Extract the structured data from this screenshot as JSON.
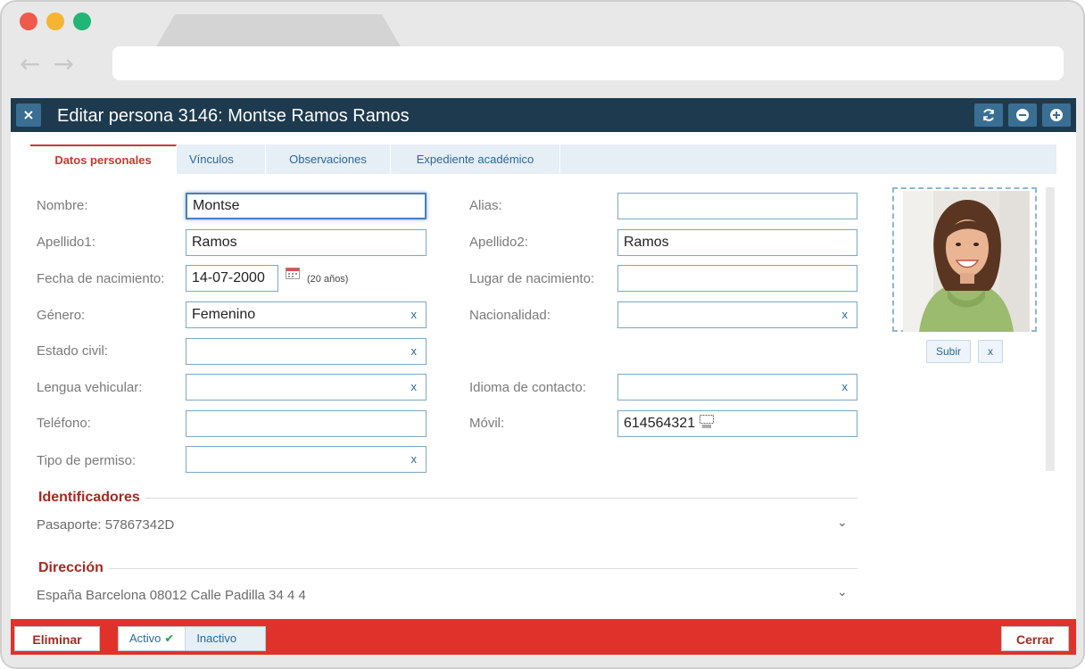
{
  "window": {
    "title": "Editar persona 3146: Montse Ramos Ramos",
    "close_glyph": "×"
  },
  "colors": {
    "titlebar": "#1d3a4f",
    "accent_red": "#e0322a",
    "section_red": "#a32a20",
    "link_blue": "#2a6a99"
  },
  "tabs": [
    {
      "label": "Datos personales",
      "active": true
    },
    {
      "label": "Vínculos",
      "active": false
    },
    {
      "label": "Observaciones",
      "active": false
    },
    {
      "label": "Expediente académico",
      "active": false
    }
  ],
  "form": {
    "nombre": {
      "label": "Nombre:",
      "value": "Montse"
    },
    "apellido1": {
      "label": "Apellido1:",
      "value": "Ramos"
    },
    "fecha": {
      "label": "Fecha de nacimiento:",
      "value": "14-07-2000",
      "age": "(20 años)"
    },
    "genero": {
      "label": "Género:",
      "value": "Femenino",
      "clear": "x"
    },
    "estado_civil": {
      "label": "Estado civil:",
      "value": "",
      "clear": "x"
    },
    "lengua": {
      "label": "Lengua vehicular:",
      "value": "",
      "clear": "x"
    },
    "telefono": {
      "label": "Teléfono:",
      "value": ""
    },
    "permiso": {
      "label": "Tipo de permiso:",
      "value": "",
      "clear": "x"
    },
    "alias": {
      "label": "Alias:",
      "value": ""
    },
    "apellido2": {
      "label": "Apellido2:",
      "value": "Ramos"
    },
    "lugar": {
      "label": "Lugar de nacimiento:",
      "value": ""
    },
    "nacionalidad": {
      "label": "Nacionalidad:",
      "value": "",
      "clear": "x"
    },
    "idioma": {
      "label": "Idioma de contacto:",
      "value": "",
      "clear": "x"
    },
    "movil": {
      "label": "Móvil:",
      "value": "614564321"
    }
  },
  "photo": {
    "upload_label": "Subir",
    "remove_label": "x"
  },
  "sections": {
    "identificadores": {
      "title": "Identificadores",
      "value": "Pasaporte: 57867342D"
    },
    "direccion": {
      "title": "Dirección",
      "value": "España Barcelona 08012 Calle Padilla 34 4 4"
    }
  },
  "footer": {
    "delete_label": "Eliminar",
    "active_label": "Activo",
    "inactive_label": "Inactivo",
    "close_label": "Cerrar"
  }
}
